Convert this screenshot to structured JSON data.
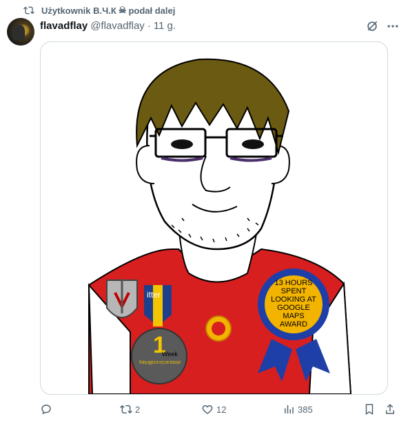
{
  "repost": {
    "user": "Użytkownik В.Ч.К",
    "suffix": "podał dalej"
  },
  "tweet": {
    "display_name": "flavadflay",
    "handle": "@flavadflay",
    "separator": "·",
    "time": "11 g."
  },
  "image": {
    "badge_ribbon_text": "itter",
    "medal_number": "1",
    "medal_unit": "Week",
    "medal_caption": "Posting viggle.ai on my jt.com alt account",
    "award_text": [
      "13 HOURS",
      "SPENT",
      "LOOKING AT",
      "GOOGLE",
      "MAPS",
      "AWARD"
    ]
  },
  "actions": {
    "reply_count": "",
    "repost_count": "2",
    "like_count": "12",
    "views_count": "385"
  },
  "colors": {
    "shirt": "#d71f1f",
    "hair": "#6b5a12",
    "award_ring": "#1f3fa8",
    "award_center": "#f3b400"
  }
}
